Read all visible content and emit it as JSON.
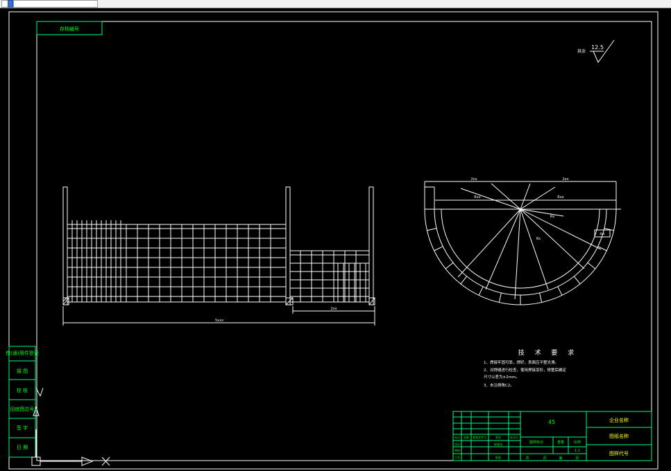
{
  "app": {
    "tabs": [
      "",
      "",
      ""
    ]
  },
  "drawing": {
    "surface_roughness": {
      "label": "其余",
      "value": "12.5"
    },
    "top_left_box": "存档编号",
    "left_strip": [
      "借(通)用件登记",
      "描 图",
      "校 核",
      "旧底图总号",
      "签 字",
      "日 期"
    ],
    "front_view": {
      "overall_dim": "5xxx",
      "right_dim": "2xx"
    },
    "plan_view": {
      "dims": [
        "2xx",
        "2xx",
        "Rxx",
        "Rxx",
        "Rx",
        "8x",
        "4xx"
      ],
      "side_label": "8xx"
    },
    "tech_req": {
      "title": "技 术 要 求",
      "items": [
        "1、焊接牢固可靠，焊好，表面应平整光滑。",
        "2、对焊缝进行检查，使用焊接变形，修整后确定",
        "     尺寸公差为±2mm。",
        "3、未注倒角C2。"
      ]
    },
    "title_block": {
      "material": "45",
      "company": "企业名称",
      "drawing_name": "图纸名称",
      "drawing_no": "图样代号",
      "header_labels": [
        "图样标记",
        "重量",
        "比例"
      ],
      "scale": "1:1",
      "sheet_labels": [
        "共",
        "页",
        "第",
        "页"
      ],
      "left_labels": [
        "标记",
        "处数",
        "分区",
        "更改文件号",
        "签名",
        "年月日",
        "设计",
        "标准化",
        "审核",
        "工艺",
        "批准"
      ]
    },
    "colors": {
      "line": "#ffffff",
      "frame": "#00ff7f",
      "text_green": "#00ff00",
      "accent_yellow": "#ffff00"
    }
  }
}
